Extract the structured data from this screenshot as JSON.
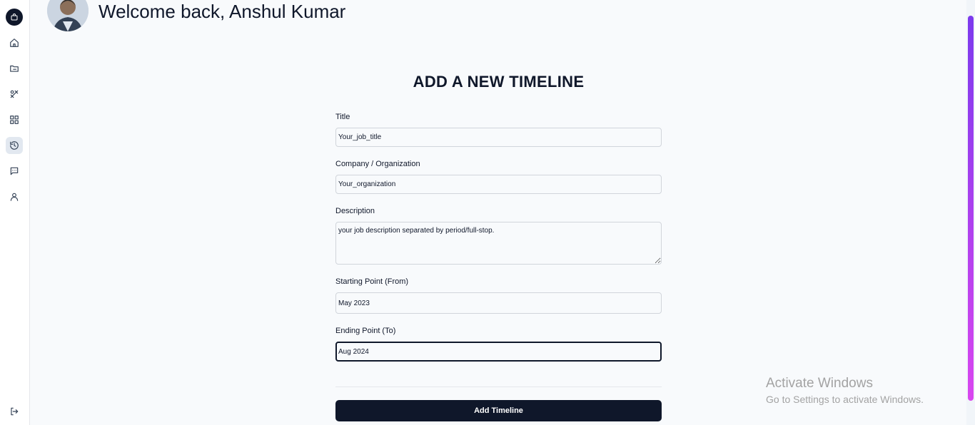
{
  "header": {
    "welcome": "Welcome back, Anshul Kumar"
  },
  "sidebar": {
    "items": [
      {
        "icon": "bag-icon"
      },
      {
        "icon": "home-icon"
      },
      {
        "icon": "folder-icon"
      },
      {
        "icon": "tools-icon"
      },
      {
        "icon": "grid-icon"
      },
      {
        "icon": "history-icon",
        "active": true
      },
      {
        "icon": "message-icon"
      },
      {
        "icon": "user-icon"
      },
      {
        "icon": "logout-icon"
      }
    ]
  },
  "form": {
    "title": "ADD A NEW TIMELINE",
    "fields": {
      "title": {
        "label": "Title",
        "value": "Your_job_title"
      },
      "company": {
        "label": "Company / Organization",
        "value": "Your_organization"
      },
      "description": {
        "label": "Description",
        "value": "your job description separated by period/full-stop."
      },
      "from": {
        "label": "Starting Point (From)",
        "value": "May 2023"
      },
      "to": {
        "label": "Ending Point (To)",
        "value": "Aug 2024"
      }
    },
    "submit_label": "Add Timeline"
  },
  "watermark": {
    "line1": "Activate Windows",
    "line2": "Go to Settings to activate Windows."
  },
  "colors": {
    "primary": "#0f172a",
    "background": "#f8fafc",
    "scrollbar": "#8b5cf6"
  }
}
